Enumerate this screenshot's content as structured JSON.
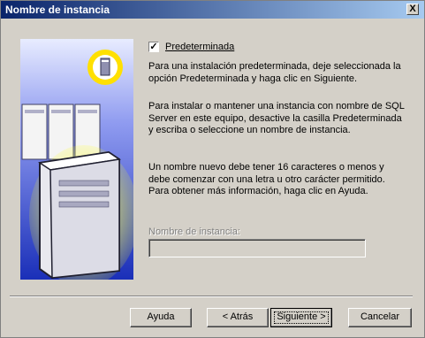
{
  "window": {
    "title": "Nombre de instancia",
    "close_label": "X"
  },
  "options": {
    "default_checkbox_label": "Predeterminada",
    "default_checked": true
  },
  "paragraphs": [
    "Para una instalación predeterminada, deje seleccionada la opción Predeterminada y haga clic en Siguiente.",
    "Para instalar o mantener una instancia con nombre de SQL Server en este equipo, desactive la casilla Predeterminada y escriba o seleccione un nombre de instancia.",
    "Un nombre nuevo debe tener 16 caracteres o menos y debe comenzar con una letra u otro carácter permitido. Para obtener más información, haga clic en Ayuda."
  ],
  "instance": {
    "label": "Nombre de instancia:",
    "value": ""
  },
  "buttons": {
    "help": "Ayuda",
    "back": "< Atrás",
    "next": "Siguiente >",
    "cancel": "Cancelar"
  },
  "icons": {
    "close": "close-icon",
    "checkmark": "checkmark-icon",
    "graphic": "servers-illustration"
  }
}
